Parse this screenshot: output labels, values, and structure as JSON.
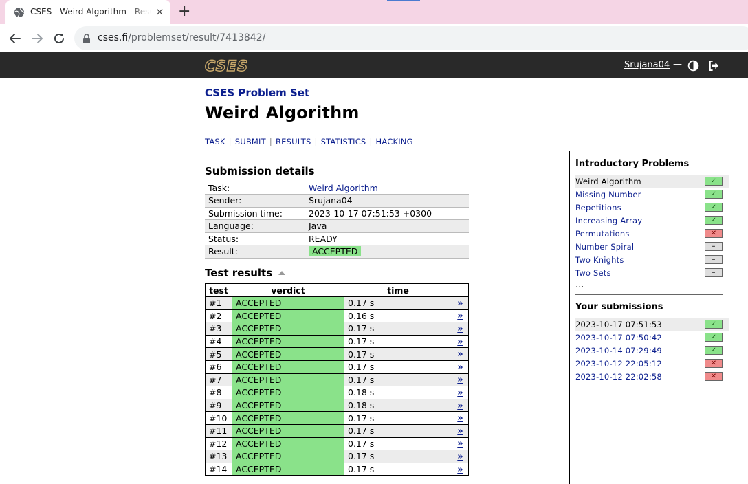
{
  "browser": {
    "tab_title": "CSES - Weird Algorithm - Results",
    "tab_close": "×",
    "new_tab": "+",
    "url_host": "cses.fi",
    "url_path": "/problemset/result/7413842/"
  },
  "header": {
    "logo": "CSES",
    "username": "Srujana04",
    "separator": "—"
  },
  "breadcrumb": "CSES Problem Set",
  "title": "Weird Algorithm",
  "subnav": [
    "TASK",
    "SUBMIT",
    "RESULTS",
    "STATISTICS",
    "HACKING"
  ],
  "details": {
    "heading": "Submission details",
    "rows": [
      {
        "label": "Task:",
        "value": "Weird Algorithm"
      },
      {
        "label": "Sender:",
        "value": "Srujana04"
      },
      {
        "label": "Submission time:",
        "value": "2023-10-17 07:51:53 +0300"
      },
      {
        "label": "Language:",
        "value": "Java"
      },
      {
        "label": "Status:",
        "value": "READY"
      },
      {
        "label": "Result:",
        "value": "ACCEPTED"
      }
    ]
  },
  "tests": {
    "heading": "Test results",
    "columns": [
      "test",
      "verdict",
      "time"
    ],
    "link_glyph": "»",
    "rows": [
      {
        "test": "#1",
        "verdict": "ACCEPTED",
        "time": "0.17 s"
      },
      {
        "test": "#2",
        "verdict": "ACCEPTED",
        "time": "0.16 s"
      },
      {
        "test": "#3",
        "verdict": "ACCEPTED",
        "time": "0.17 s"
      },
      {
        "test": "#4",
        "verdict": "ACCEPTED",
        "time": "0.17 s"
      },
      {
        "test": "#5",
        "verdict": "ACCEPTED",
        "time": "0.17 s"
      },
      {
        "test": "#6",
        "verdict": "ACCEPTED",
        "time": "0.17 s"
      },
      {
        "test": "#7",
        "verdict": "ACCEPTED",
        "time": "0.17 s"
      },
      {
        "test": "#8",
        "verdict": "ACCEPTED",
        "time": "0.18 s"
      },
      {
        "test": "#9",
        "verdict": "ACCEPTED",
        "time": "0.18 s"
      },
      {
        "test": "#10",
        "verdict": "ACCEPTED",
        "time": "0.17 s"
      },
      {
        "test": "#11",
        "verdict": "ACCEPTED",
        "time": "0.17 s"
      },
      {
        "test": "#12",
        "verdict": "ACCEPTED",
        "time": "0.17 s"
      },
      {
        "test": "#13",
        "verdict": "ACCEPTED",
        "time": "0.17 s"
      },
      {
        "test": "#14",
        "verdict": "ACCEPTED",
        "time": "0.17 s"
      }
    ]
  },
  "sidebar": {
    "section_title": "Introductory Problems",
    "problems": [
      {
        "name": "Weird Algorithm",
        "status": "ok",
        "current": true
      },
      {
        "name": "Missing Number",
        "status": "ok"
      },
      {
        "name": "Repetitions",
        "status": "ok"
      },
      {
        "name": "Increasing Array",
        "status": "ok"
      },
      {
        "name": "Permutations",
        "status": "bad"
      },
      {
        "name": "Number Spiral",
        "status": "none"
      },
      {
        "name": "Two Knights",
        "status": "none"
      },
      {
        "name": "Two Sets",
        "status": "none"
      }
    ],
    "more": "...",
    "submissions_title": "Your submissions",
    "submissions": [
      {
        "time": "2023-10-17 07:51:53",
        "status": "ok",
        "current": true
      },
      {
        "time": "2023-10-17 07:50:42",
        "status": "ok"
      },
      {
        "time": "2023-10-14 07:29:49",
        "status": "ok"
      },
      {
        "time": "2023-10-12 22:05:12",
        "status": "bad"
      },
      {
        "time": "2023-10-12 22:02:58",
        "status": "bad"
      }
    ],
    "status_glyphs": {
      "ok": "✓",
      "bad": "✕",
      "none": "–"
    }
  },
  "colors": {
    "accepted": "#8ae28a",
    "rejected": "#f08b8b",
    "link": "#0c1f8e",
    "header_bg": "#292929"
  }
}
